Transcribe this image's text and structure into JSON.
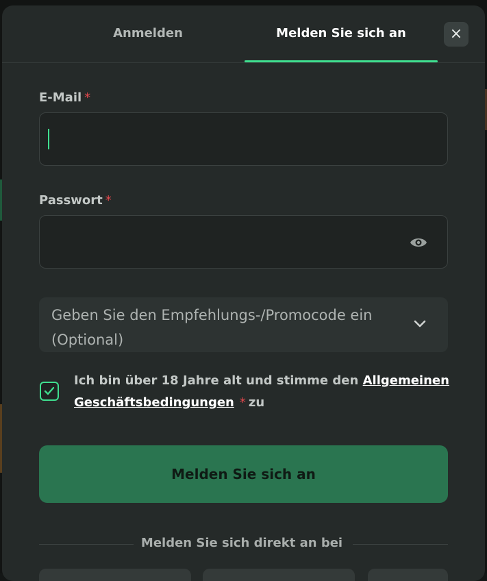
{
  "tabs": {
    "login_label": "Anmelden",
    "register_label": "Melden Sie sich an"
  },
  "close_label": "×",
  "email": {
    "label": "E-Mail",
    "required_mark": "*",
    "value": "",
    "placeholder": ""
  },
  "password": {
    "label": "Passwort",
    "required_mark": "*",
    "value": "",
    "placeholder": ""
  },
  "promo": {
    "text": "Geben Sie den Empfehlungs-/Promocode ein (Optional)"
  },
  "terms": {
    "checked": true,
    "text_before": "Ich bin über 18 Jahre alt und stimme den",
    "link_text": "Allgemeinen Geschäftsbedingungen",
    "required_mark": "*",
    "text_after": "zu"
  },
  "submit_label": "Melden Sie sich an",
  "social_divider_text": "Melden Sie sich direkt an bei",
  "colors": {
    "accent": "#3fdf8f",
    "submit_bg": "#2a7550",
    "modal_bg": "#252a29",
    "required": "#e5484d"
  },
  "icons": {
    "close": "close-icon",
    "password_toggle": "eye-icon",
    "promo_expand": "chevron-down-icon",
    "checkbox": "checkmark-icon"
  }
}
